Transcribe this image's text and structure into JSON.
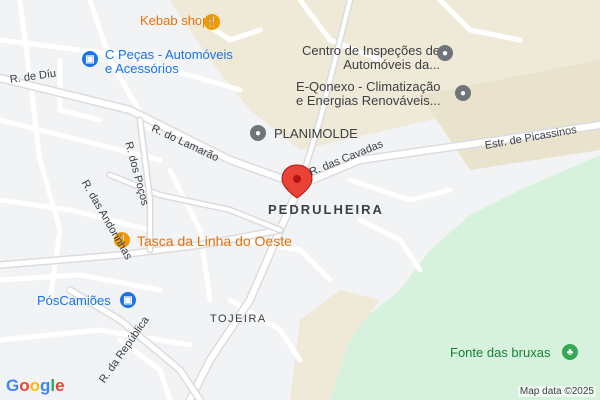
{
  "map": {
    "place_label": "PEDRULHEIRA",
    "neighborhood": "TOJEIRA",
    "attribution": "Map data ©2025",
    "logo_letters": [
      "G",
      "o",
      "o",
      "g",
      "l",
      "e"
    ],
    "colors": {
      "background": "#f1f3f4",
      "road": "#ffffff",
      "road_outline": "#dadce0",
      "green_area": "#d6f2dd",
      "tan_area": "#efe9d8",
      "marker": "#ea4335"
    }
  },
  "pois": {
    "kebab": {
      "name": "Kebab shop",
      "icon": "restaurant-icon"
    },
    "c_pecas": {
      "line1": "C Peças - Automóveis",
      "line2": "e Acessórios",
      "icon": "shopping-bag-icon"
    },
    "centro": {
      "line1": "Centro de Inspeções de",
      "line2": "Automóveis da...",
      "icon": "place-icon"
    },
    "e_qonexo": {
      "line1": "E-Qonexo - Climatização",
      "line2": "e Energias Renováveis...",
      "icon": "place-icon"
    },
    "planimolde": {
      "name": "PLANIMOLDE",
      "icon": "place-icon"
    },
    "tasca": {
      "name": "Tasca da Linha do Oeste",
      "icon": "restaurant-icon"
    },
    "poscamioes": {
      "name": "PósCamiões",
      "icon": "shopping-bag-icon"
    },
    "fonte": {
      "name": "Fonte das bruxas",
      "icon": "park-icon"
    }
  },
  "streets": {
    "diu": "R. de Díu",
    "lamarao": "R. do Lamarão",
    "pocos": "R. dos Poços",
    "andorinhas": "R. das Andorinhas",
    "cavadas": "R. das Cavadas",
    "picassinos": "Estr. de Picassinos",
    "republica": "R. da República"
  }
}
